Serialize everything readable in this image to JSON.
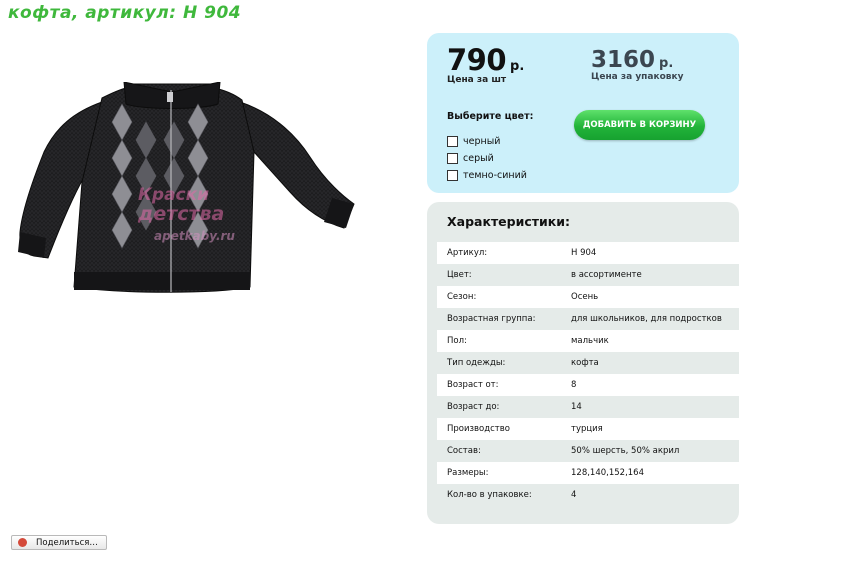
{
  "page": {
    "title": "кофта, артикул: H 904"
  },
  "product_image": {
    "alt": "кофта H 904",
    "watermark": {
      "line1": "Краски",
      "line2": "детства",
      "line3": "apetkaby.ru"
    }
  },
  "price": {
    "unit_amount": "790",
    "unit_currency": "р.",
    "unit_caption": "Цена за шт",
    "pack_amount": "3160",
    "pack_currency": "р.",
    "pack_caption": "Цена за упаковку"
  },
  "color_choice": {
    "heading": "Выберите цвет:",
    "options": [
      {
        "label": "черный",
        "checked": false
      },
      {
        "label": "серый",
        "checked": false
      },
      {
        "label": "темно-синий",
        "checked": false
      }
    ]
  },
  "cart": {
    "add_label": "ДОБАВИТЬ В КОРЗИНУ"
  },
  "specs": {
    "heading": "Характеристики:",
    "rows": [
      {
        "key": "Артикул:",
        "value": "H 904"
      },
      {
        "key": "Цвет:",
        "value": "в ассортименте"
      },
      {
        "key": "Сезон:",
        "value": "Осень"
      },
      {
        "key": "Возрастная группа:",
        "value": "для школьников, для подростков"
      },
      {
        "key": "Пол:",
        "value": "мальчик"
      },
      {
        "key": "Тип одежды:",
        "value": "кофта"
      },
      {
        "key": "Возраст от:",
        "value": "8"
      },
      {
        "key": "Возраст до:",
        "value": "14"
      },
      {
        "key": "Производство",
        "value": "турция"
      },
      {
        "key": "Состав:",
        "value": "50% шерсть, 50% акрил"
      },
      {
        "key": "Размеры:",
        "value": "128,140,152,164"
      },
      {
        "key": "Кол-во в упаковке:",
        "value": "4"
      }
    ]
  },
  "share": {
    "label": "Поделиться…",
    "icon": "share-icon"
  },
  "colors": {
    "title_green": "#3fb83c",
    "price_box_bg": "#ccf0fa",
    "specs_box_bg": "#e5ebe9",
    "cart_button_green": "#22b43a",
    "share_icon_red": "#d44a3a"
  }
}
